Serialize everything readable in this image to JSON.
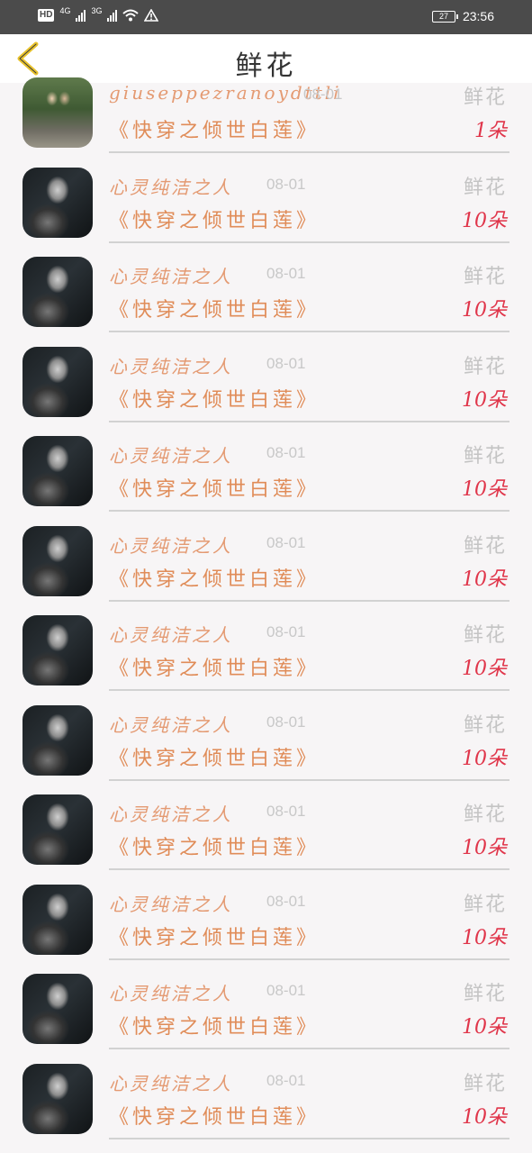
{
  "status_bar": {
    "hd_label": "HD",
    "net1": "4G",
    "net2": "3G",
    "battery": "27",
    "time": "23:56"
  },
  "header": {
    "title": "鲜花"
  },
  "list": [
    {
      "user": "giuseppezranoydttli",
      "date": "08-01",
      "gift": "鲜花",
      "book": "《快穿之倾世白莲》",
      "count": "1朵",
      "avatar": "photo"
    },
    {
      "user": "心灵纯洁之人",
      "date": "08-01",
      "gift": "鲜花",
      "book": "《快穿之倾世白莲》",
      "count": "10朵",
      "avatar": "dark"
    },
    {
      "user": "心灵纯洁之人",
      "date": "08-01",
      "gift": "鲜花",
      "book": "《快穿之倾世白莲》",
      "count": "10朵",
      "avatar": "dark"
    },
    {
      "user": "心灵纯洁之人",
      "date": "08-01",
      "gift": "鲜花",
      "book": "《快穿之倾世白莲》",
      "count": "10朵",
      "avatar": "dark"
    },
    {
      "user": "心灵纯洁之人",
      "date": "08-01",
      "gift": "鲜花",
      "book": "《快穿之倾世白莲》",
      "count": "10朵",
      "avatar": "dark"
    },
    {
      "user": "心灵纯洁之人",
      "date": "08-01",
      "gift": "鲜花",
      "book": "《快穿之倾世白莲》",
      "count": "10朵",
      "avatar": "dark"
    },
    {
      "user": "心灵纯洁之人",
      "date": "08-01",
      "gift": "鲜花",
      "book": "《快穿之倾世白莲》",
      "count": "10朵",
      "avatar": "dark"
    },
    {
      "user": "心灵纯洁之人",
      "date": "08-01",
      "gift": "鲜花",
      "book": "《快穿之倾世白莲》",
      "count": "10朵",
      "avatar": "dark"
    },
    {
      "user": "心灵纯洁之人",
      "date": "08-01",
      "gift": "鲜花",
      "book": "《快穿之倾世白莲》",
      "count": "10朵",
      "avatar": "dark"
    },
    {
      "user": "心灵纯洁之人",
      "date": "08-01",
      "gift": "鲜花",
      "book": "《快穿之倾世白莲》",
      "count": "10朵",
      "avatar": "dark"
    },
    {
      "user": "心灵纯洁之人",
      "date": "08-01",
      "gift": "鲜花",
      "book": "《快穿之倾世白莲》",
      "count": "10朵",
      "avatar": "dark"
    },
    {
      "user": "心灵纯洁之人",
      "date": "08-01",
      "gift": "鲜花",
      "book": "《快穿之倾世白莲》",
      "count": "10朵",
      "avatar": "dark"
    }
  ],
  "colors": {
    "status_bg": "#4b4b4b",
    "back_arrow": "#e8c22c",
    "name": "#e49a72",
    "book": "#e08c58",
    "count": "#e0354a",
    "muted": "#c4c4c4"
  },
  "icons": {
    "back": "chevron-left-icon",
    "wifi": "wifi-icon",
    "alert": "warning-icon",
    "battery": "battery-icon"
  }
}
